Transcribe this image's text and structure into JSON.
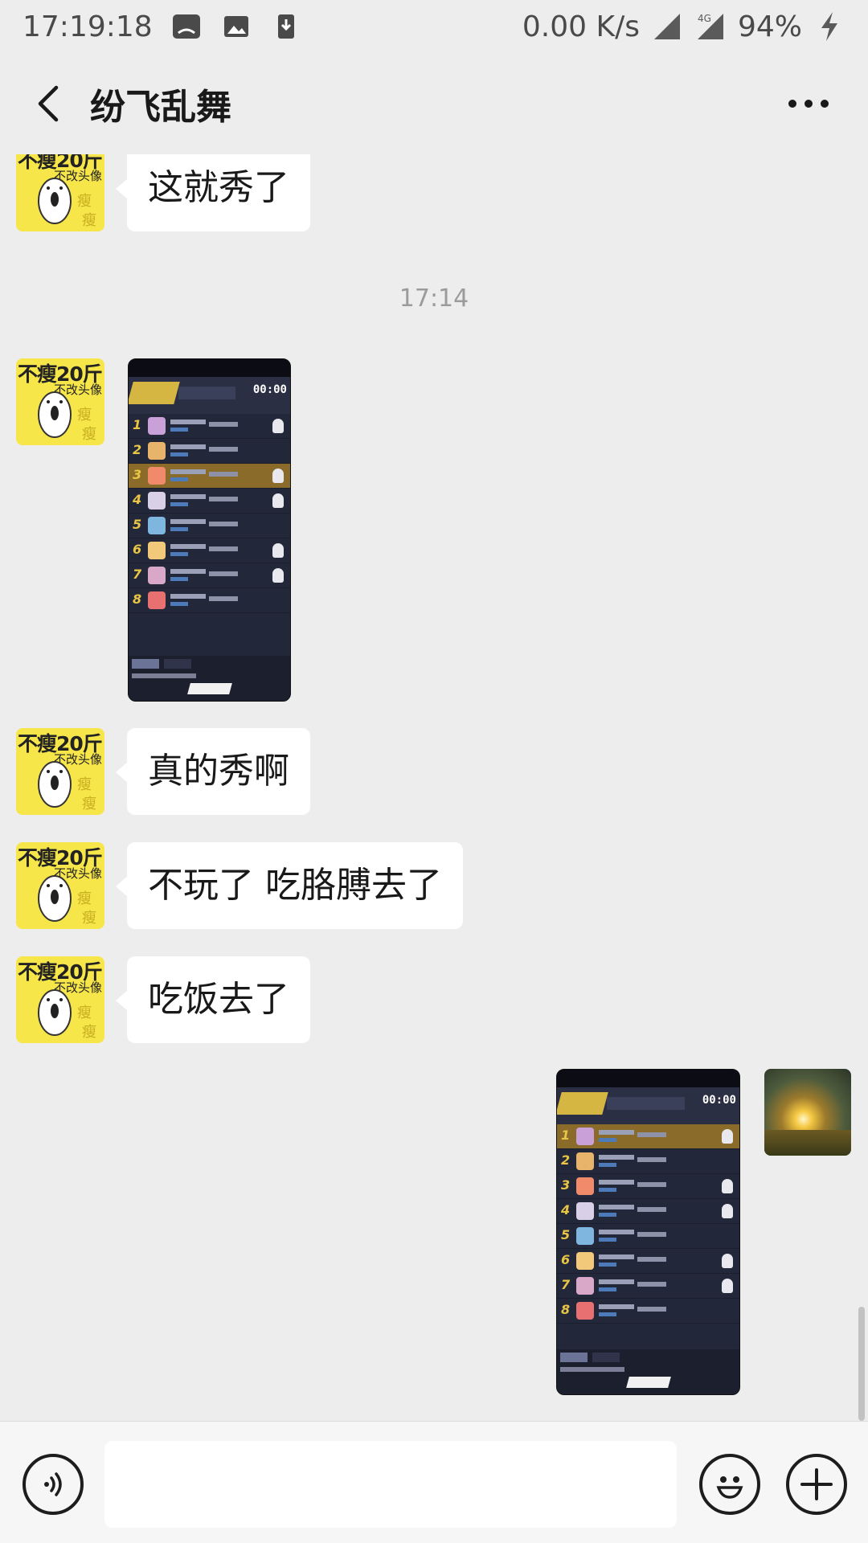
{
  "status_bar": {
    "time": "17:19:18",
    "network_speed": "0.00 K/s",
    "network_type": "4G",
    "battery": "94%"
  },
  "header": {
    "title": "纷飞乱舞",
    "back_icon": "chevron-left-icon",
    "more_icon": "more-dots-icon"
  },
  "contact_avatar": {
    "text_main": "不瘦20斤",
    "text_sub": "不改头像",
    "text_thin": "瘦"
  },
  "messages": [
    {
      "type": "text",
      "from": "contact",
      "text": "这就秀了"
    },
    {
      "type": "timestamp",
      "text": "17:14"
    },
    {
      "type": "image",
      "from": "contact",
      "description": "game-result-screenshot"
    },
    {
      "type": "text",
      "from": "contact",
      "text": "真的秀啊"
    },
    {
      "type": "text",
      "from": "contact",
      "text": "不玩了 吃胳膊去了"
    },
    {
      "type": "text",
      "from": "contact",
      "text": "吃饭去了"
    },
    {
      "type": "image",
      "from": "me",
      "description": "game-result-screenshot"
    }
  ],
  "shot_small": {
    "timer": "00:00",
    "ranks": [
      "1",
      "2",
      "3",
      "4",
      "5",
      "6",
      "7",
      "8"
    ],
    "highlight_rank": "3"
  },
  "shot_large": {
    "timer": "00:00",
    "ranks": [
      "1",
      "2",
      "3",
      "4",
      "5",
      "6",
      "7",
      "8"
    ],
    "highlight_rank": "1"
  },
  "input_bar": {
    "voice_icon": "voice-icon",
    "emoji_icon": "emoji-icon",
    "add_icon": "plus-circle-icon",
    "placeholder": ""
  },
  "colors": {
    "background": "#ededed",
    "bubble": "#ffffff",
    "avatar_yellow": "#f7e64a"
  }
}
